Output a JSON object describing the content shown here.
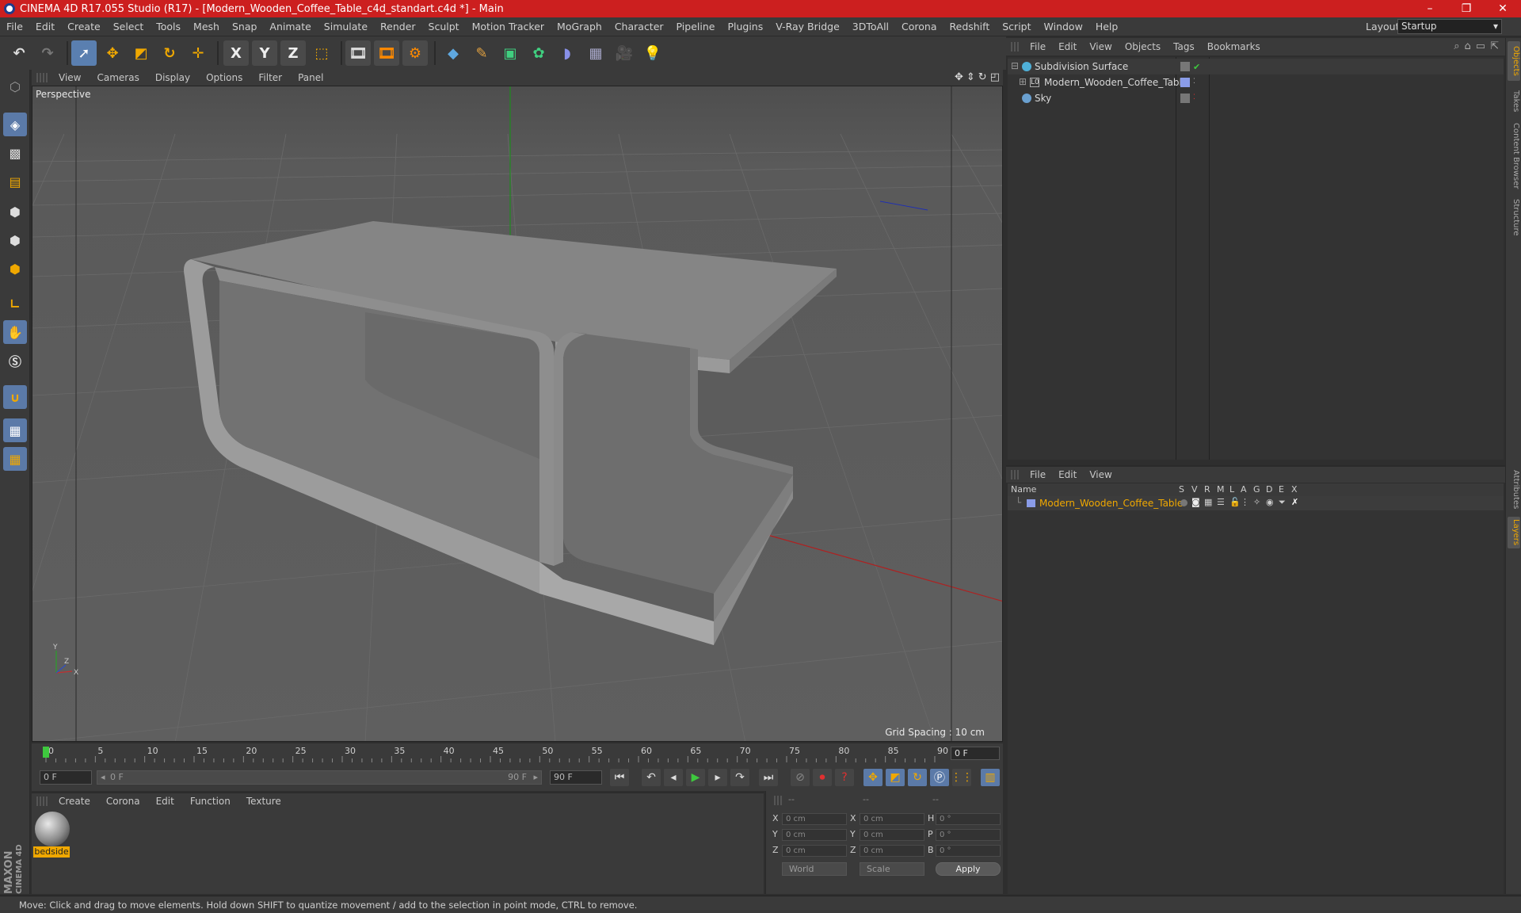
{
  "window": {
    "title": "CINEMA 4D R17.055 Studio (R17) - [Modern_Wooden_Coffee_Table_c4d_standart.c4d *] - Main",
    "controls": [
      "–",
      "❐",
      "✕"
    ]
  },
  "menubar": {
    "items": [
      "File",
      "Edit",
      "Create",
      "Select",
      "Tools",
      "Mesh",
      "Snap",
      "Animate",
      "Simulate",
      "Render",
      "Sculpt",
      "Motion Tracker",
      "MoGraph",
      "Character",
      "Pipeline",
      "Plugins",
      "V-Ray Bridge",
      "3DToAll",
      "Corona",
      "Redshift",
      "Script",
      "Window",
      "Help"
    ],
    "layout_label": "Layout:",
    "layout_value": "Startup"
  },
  "toolbar": {
    "axis_x": "X",
    "axis_y": "Y",
    "axis_z": "Z"
  },
  "viewport": {
    "menu": [
      "View",
      "Cameras",
      "Display",
      "Options",
      "Filter",
      "Panel"
    ],
    "camera_label": "Perspective",
    "grid_spacing": "Grid Spacing : 10 cm",
    "axis_labels": {
      "y": "Y",
      "x": "X",
      "z": "Z"
    }
  },
  "timeline": {
    "ticks": [
      "0",
      "5",
      "10",
      "15",
      "20",
      "25",
      "30",
      "35",
      "40",
      "45",
      "50",
      "55",
      "60",
      "65",
      "70",
      "75",
      "80",
      "85",
      "90"
    ],
    "current_frame": "0 F"
  },
  "transport": {
    "start_field": "0 F",
    "range_start": "0 F",
    "range_end": "90 F",
    "end_field": "90 F"
  },
  "material_manager": {
    "menu": [
      "Create",
      "Corona",
      "Edit",
      "Function",
      "Texture"
    ],
    "materials": [
      {
        "name": "bedside"
      }
    ]
  },
  "coordinates": {
    "headers": [
      "--",
      "--",
      "--"
    ],
    "rows": [
      {
        "label": "X",
        "pos": "0 cm",
        "label2": "X",
        "size": "0 cm",
        "rlabel": "H",
        "rot": "0 °"
      },
      {
        "label": "Y",
        "pos": "0 cm",
        "label2": "Y",
        "size": "0 cm",
        "rlabel": "P",
        "rot": "0 °"
      },
      {
        "label": "Z",
        "pos": "0 cm",
        "label2": "Z",
        "size": "0 cm",
        "rlabel": "B",
        "rot": "0 °"
      }
    ],
    "mode": "World",
    "scale_mode": "Scale",
    "apply": "Apply"
  },
  "object_manager": {
    "menu": [
      "File",
      "Edit",
      "View",
      "Objects",
      "Tags",
      "Bookmarks"
    ],
    "objects": [
      {
        "name": "Subdivision Surface",
        "icon_color": "#4fb0d8",
        "level": 0
      },
      {
        "name": "Modern_Wooden_Coffee_Table",
        "icon_color": "#8a8a8a",
        "level": 1
      },
      {
        "name": "Sky",
        "icon_color": "#6aa0d0",
        "level": 0
      }
    ]
  },
  "layer_manager": {
    "menu": [
      "File",
      "Edit",
      "View"
    ],
    "columns": {
      "name": "Name",
      "flags": [
        "S",
        "V",
        "R",
        "M",
        "L",
        "A",
        "G",
        "D",
        "E",
        "X"
      ]
    },
    "layers": [
      {
        "name": "Modern_Wooden_Coffee_Table",
        "color": "#8a9ce8"
      }
    ]
  },
  "side_tabs": [
    "Objects",
    "Takes",
    "Content Browser",
    "Structure",
    "Attributes",
    "Layers"
  ],
  "status": "Move: Click and drag to move elements. Hold down SHIFT to quantize movement / add to the selection in point mode, CTRL to remove.",
  "colors": {
    "title_bar": "#cc1f1f",
    "accent": "#f0a800",
    "tool_highlight": "#5a7fb0"
  }
}
